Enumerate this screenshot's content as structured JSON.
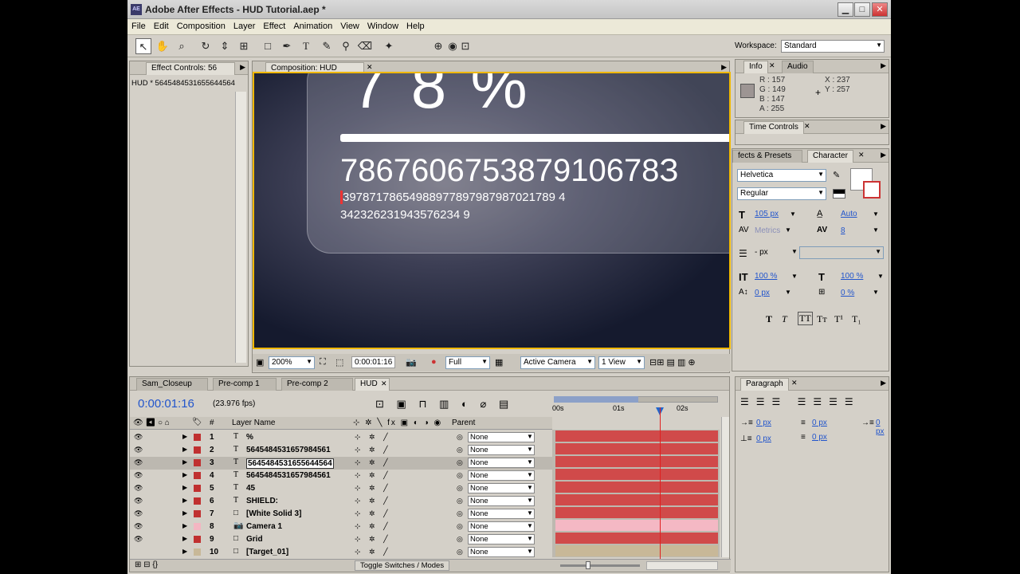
{
  "window": {
    "title": "Adobe After Effects - HUD Tutorial.aep *",
    "app_icon": "AE",
    "btn_min": "▁",
    "btn_max": "□",
    "btn_close": "✕"
  },
  "menu": [
    "File",
    "Edit",
    "Composition",
    "Layer",
    "Effect",
    "Animation",
    "View",
    "Window",
    "Help"
  ],
  "workspace": {
    "label": "Workspace:",
    "value": "Standard"
  },
  "tools": [
    "selection-tool",
    "hand-tool",
    "zoom-tool",
    "rotation-tool",
    "camera-tool",
    "pan-behind-tool",
    "rectangle-tool",
    "pen-tool",
    "type-tool",
    "brush-tool",
    "clone-stamp-tool",
    "eraser-tool",
    "puppet-tool",
    "axis-tool"
  ],
  "effect_controls": {
    "tab": "Effect Controls: 56",
    "layer": "HUD * 5645484531655644564"
  },
  "composition": {
    "tab": "Composition: HUD",
    "big_text": "7 8 %",
    "number_line": "786760675387910678З",
    "small_line1": "39787178654988977897987987021789 4",
    "small_line2": "342326231943576234 9",
    "zoom": "200%",
    "timecode": "0:00:01:16",
    "resolution": "Full",
    "camera": "Active Camera",
    "views": "1 View"
  },
  "info": {
    "tabs": [
      "Info",
      "Audio"
    ],
    "r": "R : 157",
    "g": "G : 149",
    "b": "B : 147",
    "a": "A : 255",
    "x": "X : 237",
    "y": "Y : 257"
  },
  "time_controls": {
    "tab": "Time Controls"
  },
  "character": {
    "tabs": [
      "fects & Presets",
      "Character"
    ],
    "font": "Helvetica",
    "style": "Regular",
    "size": "105 px",
    "leading": "Auto",
    "kerning": "Metrics",
    "tracking": "8",
    "stroke": "- px",
    "vscale": "100 %",
    "hscale": "100 %",
    "baseline": "0 px",
    "tsume": "0 %",
    "styles": [
      "T",
      "T",
      "TT",
      "Tт",
      "T¹",
      "T₁"
    ]
  },
  "paragraph": {
    "tab": "Paragraph",
    "indent_left": "0 px",
    "indent_right": "0 px",
    "space_before": "0 px",
    "space_after": "0 px",
    "first_line": "0 px"
  },
  "timeline": {
    "tabs": [
      "Sam_Closeup",
      "Pre-comp 1",
      "Pre-comp 2",
      "HUD"
    ],
    "timecode": "0:00:01:16",
    "fps": "(23.976 fps)",
    "col_num": "#",
    "col_name": "Layer Name",
    "col_parent": "Parent",
    "ruler": [
      "00s",
      "01s",
      "02s"
    ],
    "toggle": "Toggle Switches / Modes",
    "layers": [
      {
        "n": "1",
        "icon": "T",
        "name": "%",
        "parent": "None",
        "color": "#c03030"
      },
      {
        "n": "2",
        "icon": "T",
        "name": "5645484531657984561",
        "parent": "None",
        "color": "#c03030"
      },
      {
        "n": "3",
        "icon": "T",
        "name": "5645484531655644564",
        "parent": "None",
        "color": "#c03030"
      },
      {
        "n": "4",
        "icon": "T",
        "name": "5645484531657984561",
        "parent": "None",
        "color": "#c03030"
      },
      {
        "n": "5",
        "icon": "T",
        "name": "45",
        "parent": "None",
        "color": "#c03030"
      },
      {
        "n": "6",
        "icon": "T",
        "name": "SHIELD:",
        "parent": "None",
        "color": "#c03030"
      },
      {
        "n": "7",
        "icon": "□",
        "name": "[White Solid 3]",
        "parent": "None",
        "color": "#c03030"
      },
      {
        "n": "8",
        "icon": "📷",
        "name": "Camera 1",
        "parent": "None",
        "color": "#f4b6c2"
      },
      {
        "n": "9",
        "icon": "□",
        "name": "Grid",
        "parent": "None",
        "color": "#c03030"
      },
      {
        "n": "10",
        "icon": "□",
        "name": "[Target_01]",
        "parent": "None",
        "color": "#c8b898"
      }
    ]
  },
  "colors": {
    "swatch": "#9d9593",
    "bar_red": "#d04a4a",
    "bar_pink": "#f4b8c4",
    "bar_tan": "#c8b898",
    "timecode_blue": "#2255cc",
    "frame_yellow": "#f0b800"
  }
}
